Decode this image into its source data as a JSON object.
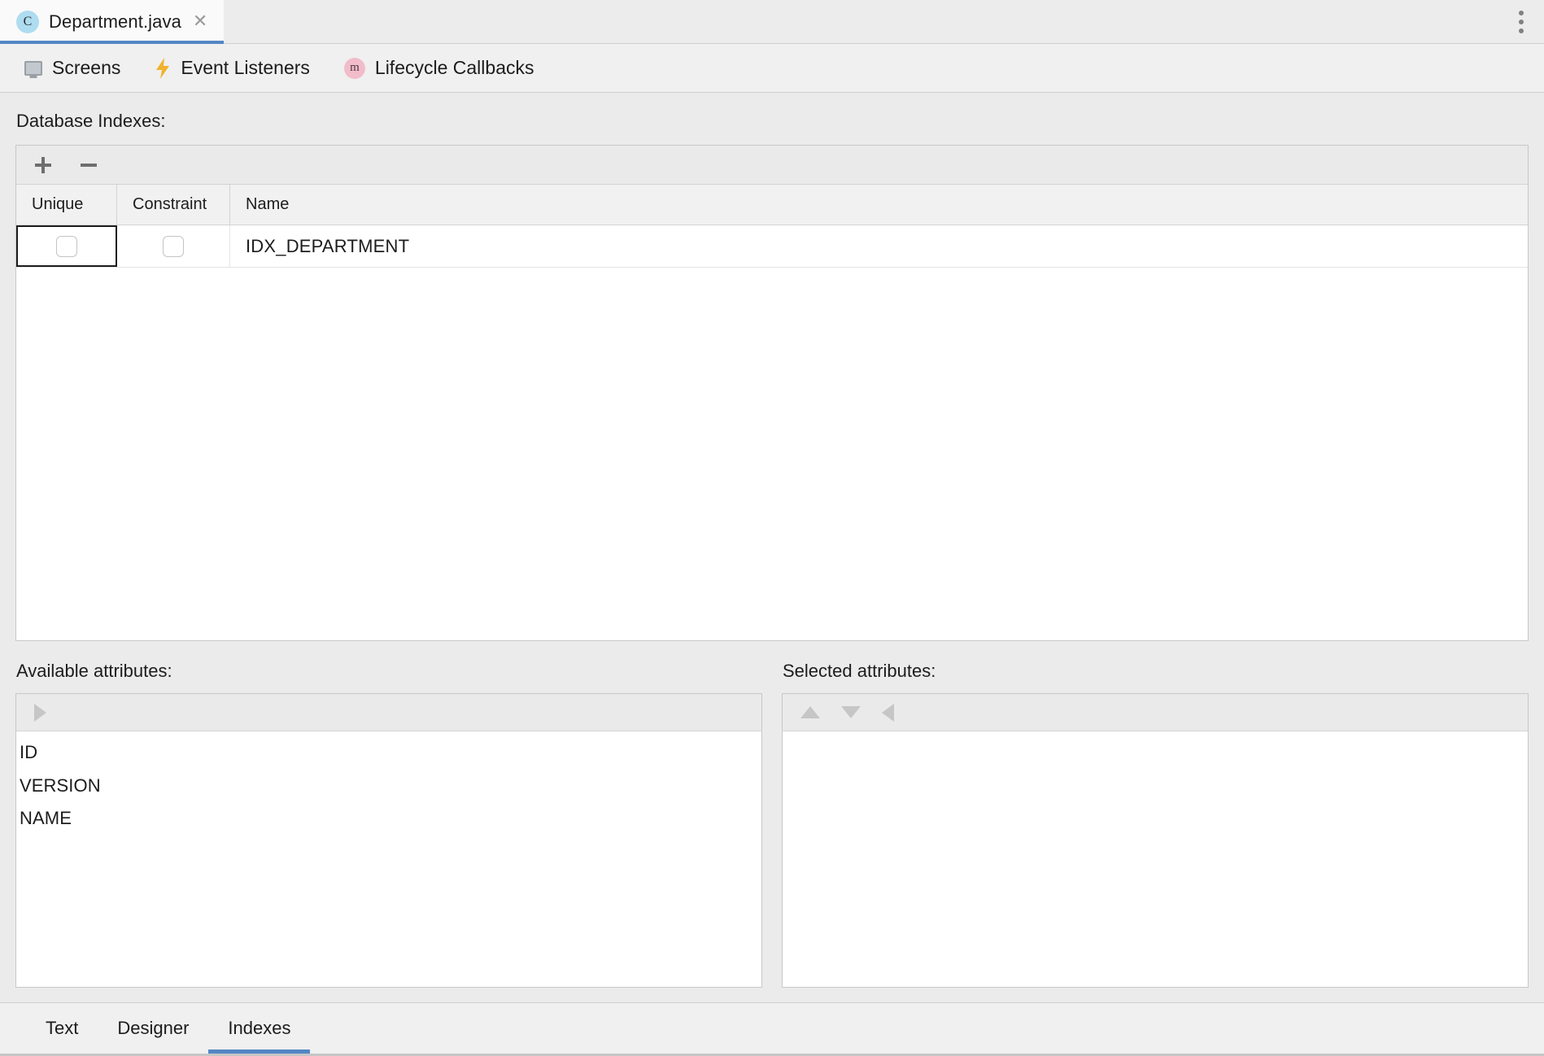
{
  "window": {
    "tab": {
      "badge": "C",
      "title": "Department.java",
      "close_icon": "close-icon"
    },
    "overflow_menu_icon": "more-vertical-icon"
  },
  "navbar": {
    "items": [
      {
        "label": "Screens",
        "icon": "monitor-icon"
      },
      {
        "label": "Event Listeners",
        "icon": "lightning-bolt-icon"
      },
      {
        "label": "Lifecycle Callbacks",
        "icon": "method-m-icon",
        "badge": "m"
      }
    ]
  },
  "indexes": {
    "section_label": "Database Indexes:",
    "toolbar": {
      "add_label": "+",
      "remove_label": "–"
    },
    "columns": [
      "Unique",
      "Constraint",
      "Name"
    ],
    "rows": [
      {
        "unique": false,
        "constraint": false,
        "name": "IDX_DEPARTMENT"
      }
    ]
  },
  "available_attributes": {
    "title": "Available attributes:",
    "toolbar_icons": [
      "arrow-right-icon"
    ],
    "items": [
      "ID",
      "VERSION",
      "NAME"
    ]
  },
  "selected_attributes": {
    "title": "Selected attributes:",
    "toolbar_icons": [
      "arrow-up-icon",
      "arrow-down-icon",
      "arrow-left-icon"
    ],
    "items": []
  },
  "bottom_tabs": {
    "items": [
      {
        "label": "Text",
        "active": false
      },
      {
        "label": "Designer",
        "active": false
      },
      {
        "label": "Indexes",
        "active": true
      }
    ]
  },
  "colors": {
    "accent": "#5486c4",
    "tab_badge": "#aedcf0",
    "callback_badge": "#f2bccb",
    "bolt": "#f0b32e",
    "panel_bg": "#ebebeb",
    "toolbar_bg": "#eaeaea"
  }
}
